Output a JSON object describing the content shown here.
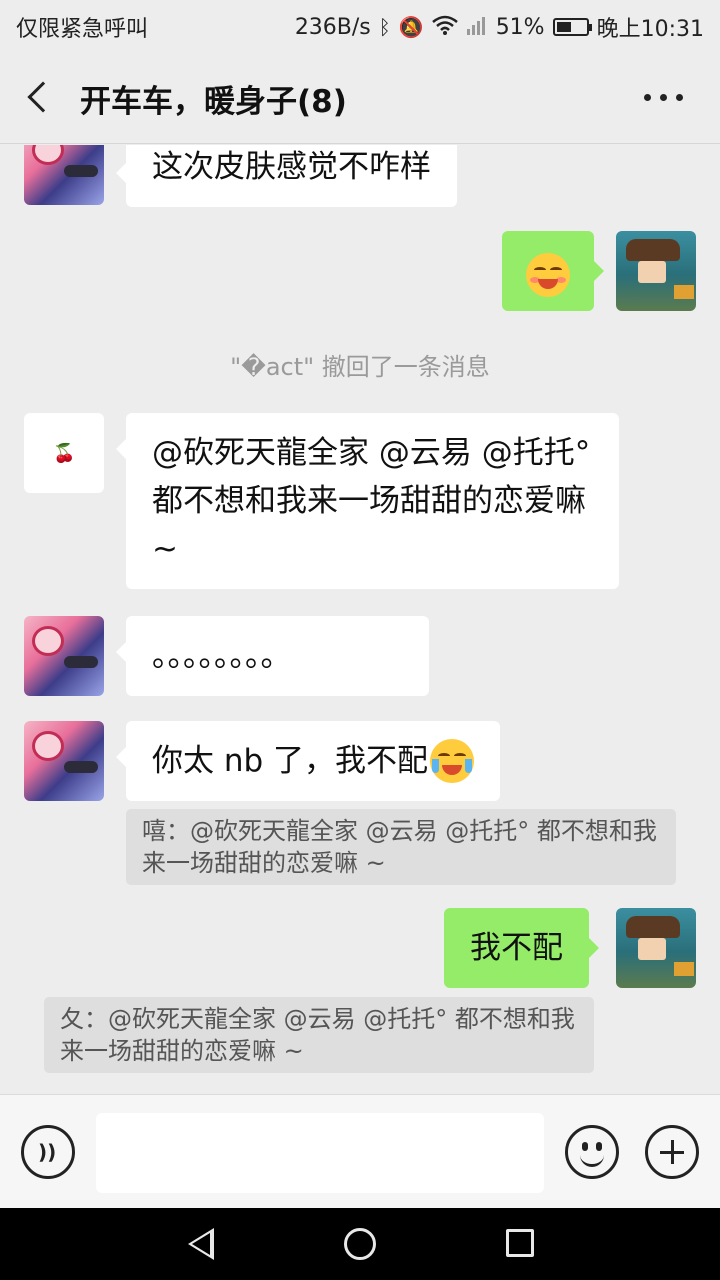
{
  "status_bar": {
    "carrier": "仅限紧急呼叫",
    "speed": "236B/s",
    "battery": "51%",
    "battery_level": 0.51,
    "time": "晚上10:31",
    "icons": [
      "bluetooth-icon",
      "mute-icon",
      "wifi-icon",
      "signal-icon",
      "battery-icon"
    ]
  },
  "header": {
    "title": "开车车，暖身子(8)"
  },
  "messages": {
    "m1": {
      "text": "这次皮肤感觉不咋样"
    },
    "m2": {
      "emoji": "blushing-emoji"
    },
    "recall": "\"�act\"",
    "recall_text": "\"�act\" 撤回了一条消息",
    "m3": {
      "text": "@砍死天龍全家  @云易  @托托° 都不想和我来一场甜甜的恋爱嘛 ~"
    },
    "m4": {
      "text": "。。。。。。。。"
    },
    "m5": {
      "text": "你太 nb 了，我不配",
      "emoji": "crying-laughing-emoji"
    },
    "m5_quote": "嘻：@砍死天龍全家 @云易 @托托° 都不想和我来一场甜甜的恋爱嘛 ~",
    "m6": {
      "text": "我不配"
    },
    "m6_quote": "夂：@砍死天龍全家 @云易 @托托° 都不想和我来一场甜甜的恋爱嘛 ~"
  },
  "input_bar": {
    "value": "",
    "placeholder": ""
  },
  "colors": {
    "background": "#ededed",
    "sent_bubble": "#95ec69",
    "received_bubble": "#ffffff",
    "quote_bg": "#dedede"
  }
}
